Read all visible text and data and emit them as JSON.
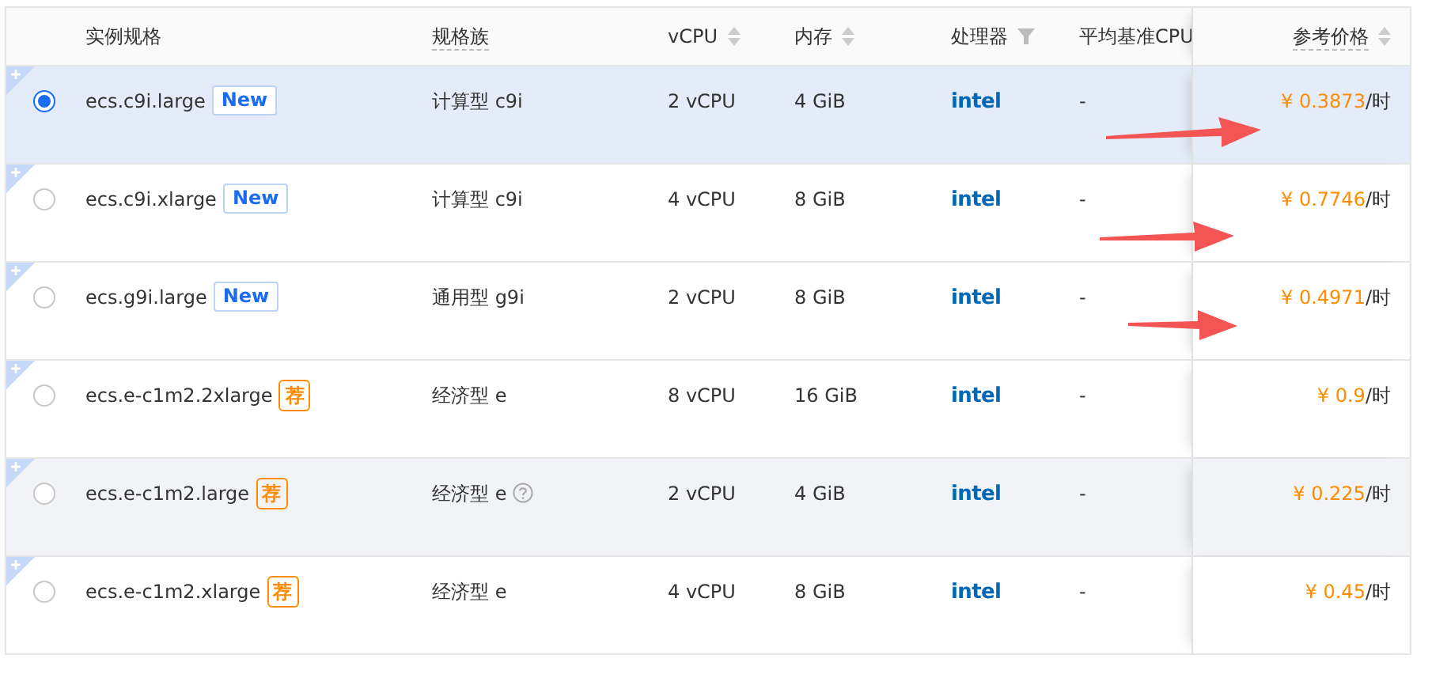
{
  "table": {
    "columns": [
      {
        "label": "实例规格",
        "kind": "plain"
      },
      {
        "label": "规格族",
        "kind": "dashed"
      },
      {
        "label": "vCPU",
        "kind": "sort"
      },
      {
        "label": "内存",
        "kind": "sort"
      },
      {
        "label": "处理器",
        "kind": "filter"
      },
      {
        "label": "平均基准CPU",
        "kind": "plain"
      },
      {
        "label": "参考价格",
        "kind": "dashed-sort"
      }
    ],
    "rows": [
      {
        "selected": true,
        "hovered": false,
        "name": "ecs.c9i.large",
        "badge": {
          "kind": "new",
          "text": "New"
        },
        "family": "计算型 c9i",
        "help": false,
        "vcpu": "2 vCPU",
        "memory": "4 GiB",
        "processor": "intel",
        "baseline": "-",
        "price": "¥ 0.3873",
        "unit": "/时"
      },
      {
        "selected": false,
        "hovered": false,
        "name": "ecs.c9i.xlarge",
        "badge": {
          "kind": "new",
          "text": "New"
        },
        "family": "计算型 c9i",
        "help": false,
        "vcpu": "4 vCPU",
        "memory": "8 GiB",
        "processor": "intel",
        "baseline": "-",
        "price": "¥ 0.7746",
        "unit": "/时"
      },
      {
        "selected": false,
        "hovered": false,
        "name": "ecs.g9i.large",
        "badge": {
          "kind": "new",
          "text": "New"
        },
        "family": "通用型 g9i",
        "help": false,
        "vcpu": "2 vCPU",
        "memory": "8 GiB",
        "processor": "intel",
        "baseline": "-",
        "price": "¥ 0.4971",
        "unit": "/时"
      },
      {
        "selected": false,
        "hovered": false,
        "name": "ecs.e-c1m2.2xlarge",
        "badge": {
          "kind": "recommend",
          "text": "荐"
        },
        "family": "经济型 e",
        "help": false,
        "vcpu": "8 vCPU",
        "memory": "16 GiB",
        "processor": "intel",
        "baseline": "-",
        "price": "¥ 0.9",
        "unit": "/时"
      },
      {
        "selected": false,
        "hovered": true,
        "name": "ecs.e-c1m2.large",
        "badge": {
          "kind": "recommend",
          "text": "荐"
        },
        "family": "经济型 e",
        "help": true,
        "vcpu": "2 vCPU",
        "memory": "4 GiB",
        "processor": "intel",
        "baseline": "-",
        "price": "¥ 0.225",
        "unit": "/时"
      },
      {
        "selected": false,
        "hovered": false,
        "name": "ecs.e-c1m2.xlarge",
        "badge": {
          "kind": "recommend",
          "text": "荐"
        },
        "family": "经济型 e",
        "help": false,
        "vcpu": "4 vCPU",
        "memory": "8 GiB",
        "processor": "intel",
        "baseline": "-",
        "price": "¥ 0.45",
        "unit": "/时"
      }
    ]
  }
}
